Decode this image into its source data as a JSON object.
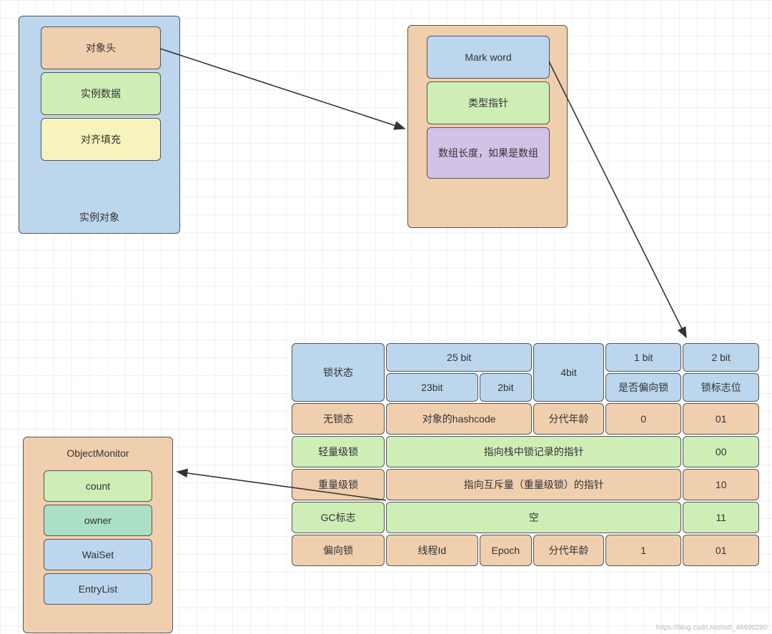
{
  "instance": {
    "title": "实例对象",
    "header": "对象头",
    "data": "实例数据",
    "padding": "对齐填充"
  },
  "header_panel": {
    "mark": "Mark  word",
    "type_ptr": "类型指针",
    "array_len": "数组长度，如果是数组"
  },
  "monitor": {
    "title": "ObjectMonitor",
    "count": "count",
    "owner": "owner",
    "waitset": "WaiSet",
    "entrylist": "EntryList"
  },
  "table": {
    "lock_state": "锁状态",
    "h25": "25 bit",
    "h4": "4bit",
    "h1": "1 bit",
    "h2": "2 bit",
    "h23": "23bit",
    "h2s": "2bit",
    "biased_q": "是否偏向锁",
    "flag": "锁标志位",
    "r1": {
      "c0": "无锁态",
      "c1": "对象的hashcode",
      "c2": "分代年龄",
      "c3": "0",
      "c4": "01"
    },
    "r2": {
      "c0": "轻量级锁",
      "c1": "指向栈中锁记录的指针",
      "c2": "00"
    },
    "r3": {
      "c0": "重量级锁",
      "c1": "指向互斥量（重量级锁）的指针",
      "c2": "10"
    },
    "r4": {
      "c0": "GC标志",
      "c1": "空",
      "c2": "11"
    },
    "r5": {
      "c0": "偏向锁",
      "c1": "线程Id",
      "c2": "Epoch",
      "c3": "分代年龄",
      "c4": "1",
      "c5": "01"
    }
  },
  "watermark": "https://blog.csdn.net/m0_46690280"
}
